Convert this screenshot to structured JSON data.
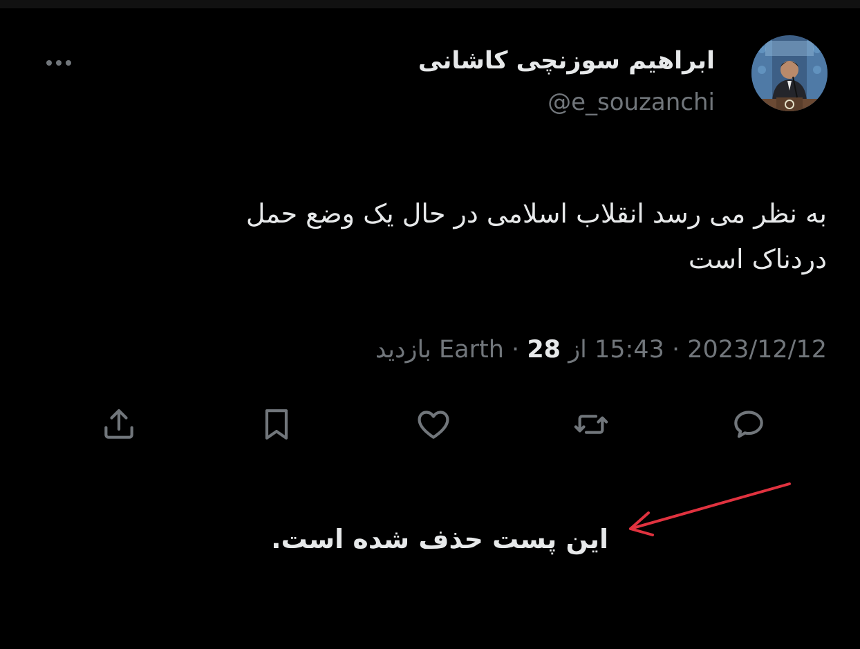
{
  "author": {
    "display_name": "ابراهیم سوزنچی کاشانی",
    "handle": "@e_souzanchi",
    "avatar_icon": "profile-photo"
  },
  "tweet": {
    "text_line1": "به نظر می رسد انقلاب اسلامی در حال یک وضع حمل",
    "text_line2": "دردناک است",
    "date": "2023/12/12",
    "time": "15:43",
    "from_label": "از",
    "source": "Earth",
    "separator": "·",
    "views_count": "28",
    "views_label": "بازدید"
  },
  "actions": [
    {
      "name": "reply",
      "icon": "reply-icon"
    },
    {
      "name": "retweet",
      "icon": "retweet-icon"
    },
    {
      "name": "like",
      "icon": "heart-icon"
    },
    {
      "name": "bookmark",
      "icon": "bookmark-icon"
    },
    {
      "name": "share",
      "icon": "share-icon"
    }
  ],
  "annotation": {
    "text": "این پست حذف شده است.",
    "arrow_color": "#e0323f"
  },
  "colors": {
    "background": "#000000",
    "text": "#e7e9ea",
    "muted": "#71767b"
  }
}
